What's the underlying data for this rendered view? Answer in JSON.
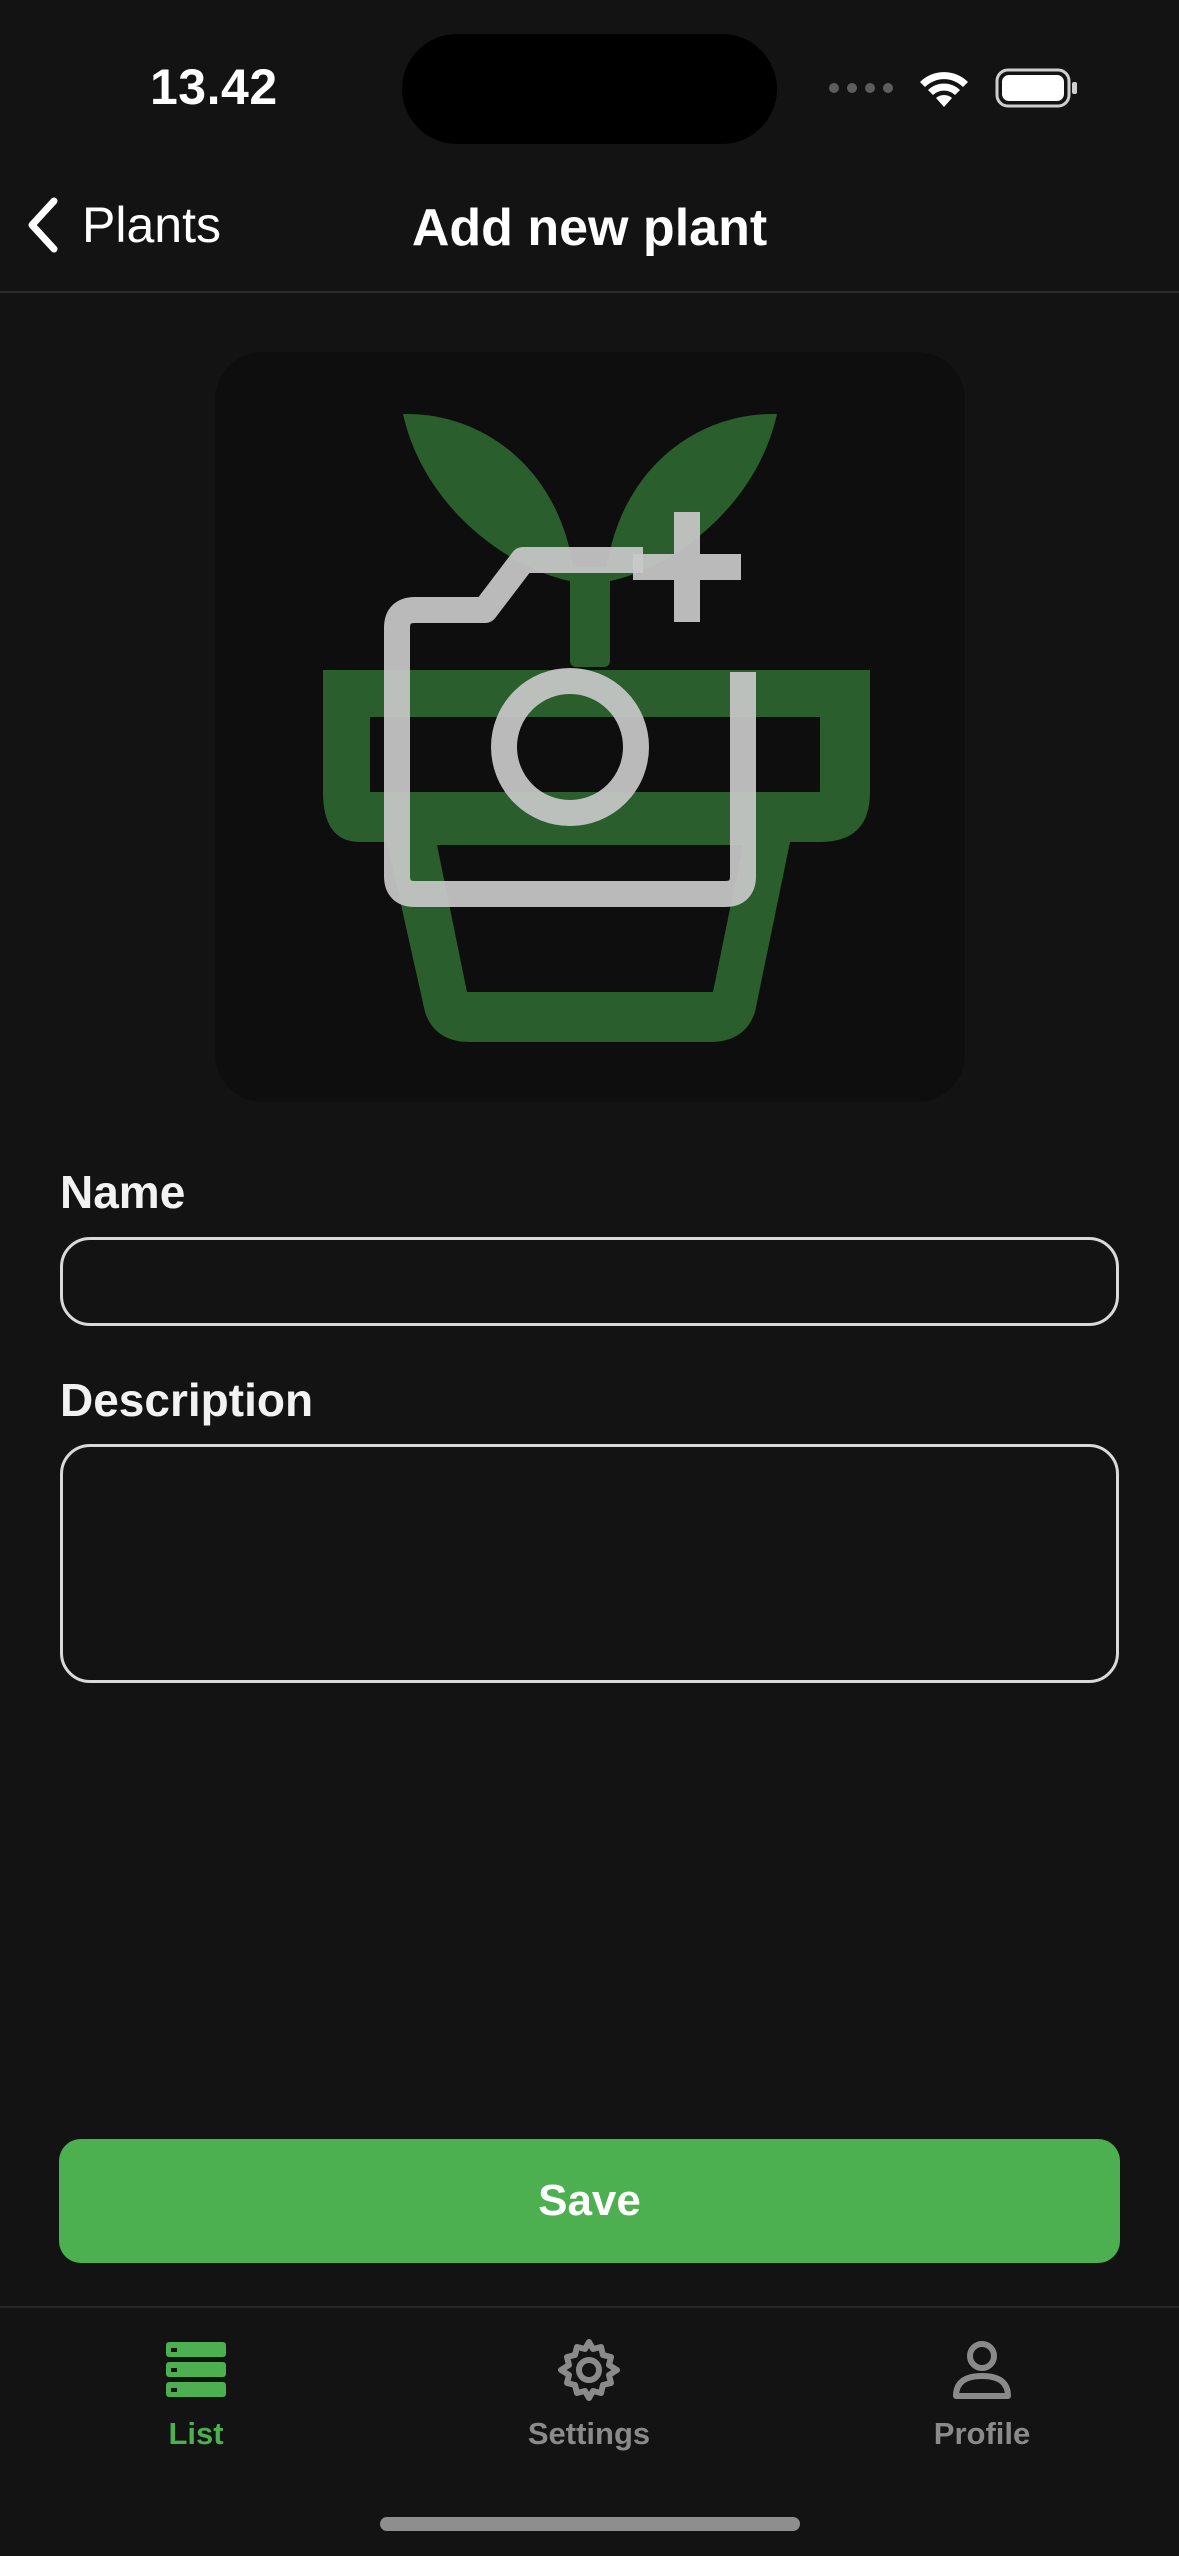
{
  "status_bar": {
    "time": "13.42"
  },
  "nav": {
    "back_label": "Plants",
    "title": "Add new plant"
  },
  "photo_picker": {
    "icons": [
      "plant-pot-icon",
      "add-photo-camera-icon"
    ]
  },
  "form": {
    "name_label": "Name",
    "name_value": "",
    "description_label": "Description",
    "description_value": ""
  },
  "actions": {
    "save_label": "Save"
  },
  "tab_bar": {
    "tabs": [
      {
        "label": "List",
        "icon": "list-icon",
        "active": true
      },
      {
        "label": "Settings",
        "icon": "gear-icon",
        "active": false
      },
      {
        "label": "Profile",
        "icon": "person-icon",
        "active": false
      }
    ]
  },
  "colors": {
    "background": "#131313",
    "accent": "#4caf50",
    "plant_green": "#2b5e2d",
    "inactive_tab": "#8a8a8a"
  }
}
